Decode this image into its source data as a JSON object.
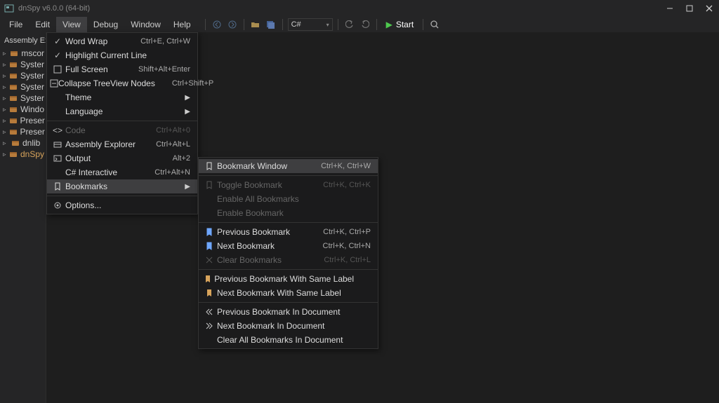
{
  "title": "dnSpy v6.0.0 (64-bit)",
  "menus": {
    "file": "File",
    "edit": "Edit",
    "view": "View",
    "debug": "Debug",
    "window": "Window",
    "help": "Help"
  },
  "toolbar": {
    "language": "C#",
    "start": "Start"
  },
  "sidebar": {
    "title": "Assembly Ex",
    "items": [
      {
        "label": "mscor"
      },
      {
        "label": "Syster"
      },
      {
        "label": "Syster"
      },
      {
        "label": "Syster"
      },
      {
        "label": "Syster"
      },
      {
        "label": "Windo"
      },
      {
        "label": "Preser"
      },
      {
        "label": "Preser"
      },
      {
        "label": "dnlib"
      },
      {
        "label": "dnSpy"
      }
    ]
  },
  "view_menu": {
    "word_wrap": "Word Wrap",
    "word_wrap_s": "Ctrl+E, Ctrl+W",
    "hl_line": "Highlight Current Line",
    "full_screen": "Full Screen",
    "full_screen_s": "Shift+Alt+Enter",
    "collapse": "Collapse TreeView Nodes",
    "collapse_s": "Ctrl+Shift+P",
    "theme": "Theme",
    "language": "Language",
    "code": "Code",
    "code_s": "Ctrl+Alt+0",
    "asm_expl": "Assembly Explorer",
    "asm_expl_s": "Ctrl+Alt+L",
    "output": "Output",
    "output_s": "Alt+2",
    "cs_interactive": "C# Interactive",
    "cs_interactive_s": "Ctrl+Alt+N",
    "bookmarks": "Bookmarks",
    "options": "Options..."
  },
  "bookmarks_menu": {
    "window": "Bookmark Window",
    "window_s": "Ctrl+K, Ctrl+W",
    "toggle": "Toggle Bookmark",
    "toggle_s": "Ctrl+K, Ctrl+K",
    "enable_all": "Enable All Bookmarks",
    "enable": "Enable Bookmark",
    "prev": "Previous Bookmark",
    "prev_s": "Ctrl+K, Ctrl+P",
    "next": "Next Bookmark",
    "next_s": "Ctrl+K, Ctrl+N",
    "clear": "Clear Bookmarks",
    "clear_s": "Ctrl+K, Ctrl+L",
    "prev_label": "Previous Bookmark With Same Label",
    "next_label": "Next Bookmark With Same Label",
    "prev_doc": "Previous Bookmark In Document",
    "next_doc": "Next Bookmark In Document",
    "clear_doc": "Clear All Bookmarks In Document"
  }
}
